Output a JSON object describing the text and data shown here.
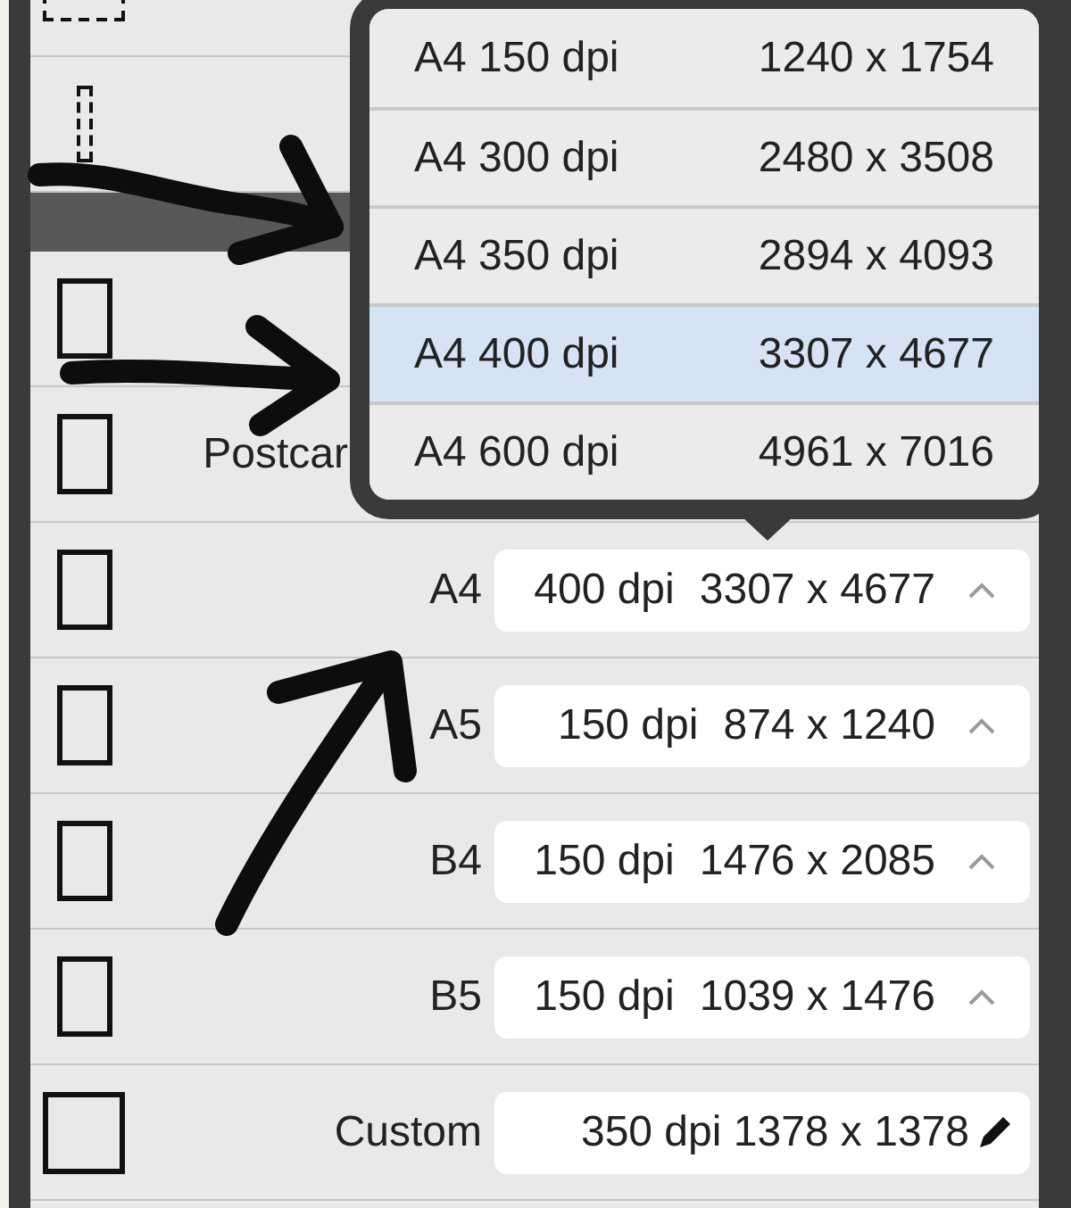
{
  "popup": {
    "options": [
      {
        "name": "A4 150 dpi",
        "size": "1240 x 1754",
        "selected": false
      },
      {
        "name": "A4 300 dpi",
        "size": "2480 x 3508",
        "selected": false
      },
      {
        "name": "A4 350 dpi",
        "size": "2894 x 4093",
        "selected": false
      },
      {
        "name": "A4 400 dpi",
        "size": "3307 x 4677",
        "selected": true
      },
      {
        "name": "A4 600 dpi",
        "size": "4961 x 7016",
        "selected": false
      }
    ]
  },
  "rows": [
    {
      "kind": "blank",
      "icon": {
        "kind": "landscape",
        "dashed": true
      }
    },
    {
      "kind": "blank",
      "icon": {
        "kind": "strip",
        "dashed": true
      }
    },
    {
      "kind": "band"
    },
    {
      "kind": "blank",
      "icon": {
        "kind": "portrait",
        "dashed": false
      }
    },
    {
      "kind": "blank",
      "icon": {
        "kind": "portrait",
        "dashed": false
      },
      "label": "Postcar"
    },
    {
      "kind": "select",
      "icon": {
        "kind": "portrait",
        "dashed": false
      },
      "label": "A4",
      "resolution": "400 dpi",
      "size": "3307 x 4677"
    },
    {
      "kind": "select",
      "icon": {
        "kind": "portrait",
        "dashed": false
      },
      "label": "A5",
      "resolution": "150 dpi",
      "size": "874 x 1240"
    },
    {
      "kind": "select",
      "icon": {
        "kind": "portrait",
        "dashed": false
      },
      "label": "B4",
      "resolution": "150 dpi",
      "size": "1476 x 2085"
    },
    {
      "kind": "select",
      "icon": {
        "kind": "portrait",
        "dashed": false
      },
      "label": "B5",
      "resolution": "150 dpi",
      "size": "1039 x 1476"
    },
    {
      "kind": "custom",
      "icon": {
        "kind": "square",
        "dashed": false
      },
      "label": "Custom",
      "value": "350 dpi 1378 x 1378"
    }
  ]
}
